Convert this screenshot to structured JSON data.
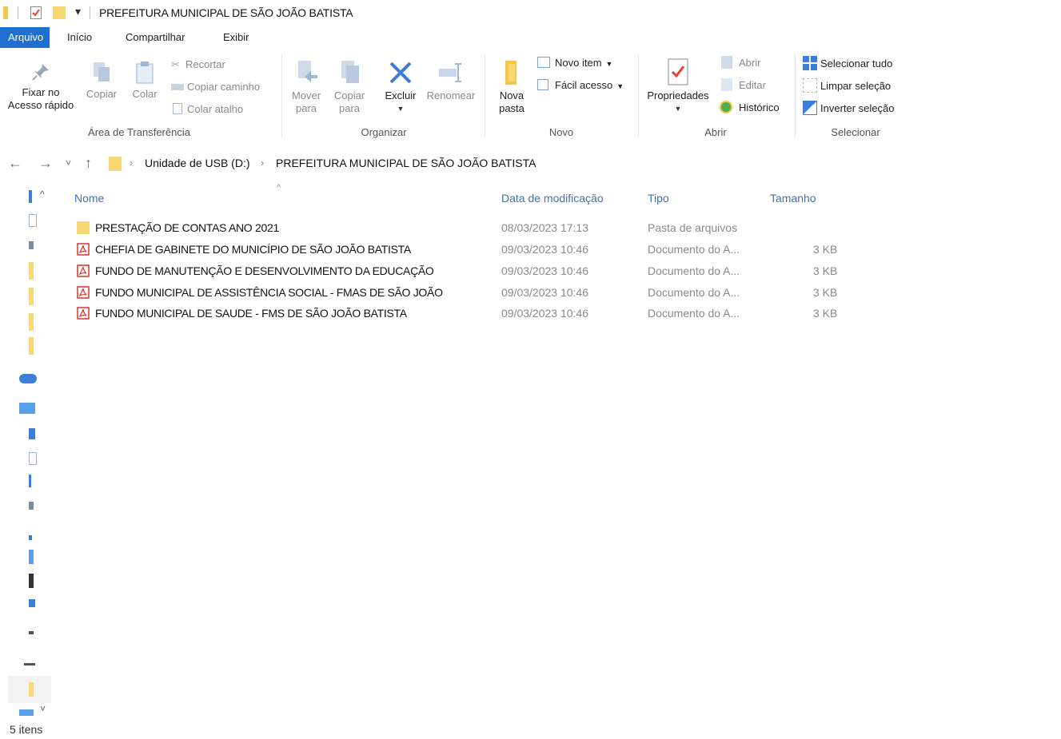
{
  "window": {
    "title": "PREFEITURA MUNICIPAL DE SÃO JOÃO BATISTA",
    "qa_menu_glyph": "▾"
  },
  "tabs": [
    {
      "label": "Arquivo",
      "active": true
    },
    {
      "label": "Início",
      "active": false
    },
    {
      "label": "Compartilhar",
      "active": false
    },
    {
      "label": "Exibir",
      "active": false
    }
  ],
  "ribbon": {
    "clipboard": {
      "pin_line1": "Fixar no",
      "pin_line2": "Acesso rápido",
      "copy": "Copiar",
      "paste": "Colar",
      "cut": "Recortar",
      "copy_path": "Copiar caminho",
      "paste_shortcut": "Colar atalho",
      "group": "Área de Transferência"
    },
    "organize": {
      "move_line1": "Mover",
      "move_line2": "para",
      "copyto_line1": "Copiar",
      "copyto_line2": "para",
      "delete": "Excluir",
      "rename": "Renomear",
      "group": "Organizar"
    },
    "new": {
      "folder_line1": "Nova",
      "folder_line2": "pasta",
      "new_item": "Novo item",
      "easy_access": "Fácil acesso",
      "group": "Novo"
    },
    "open": {
      "properties": "Propriedades",
      "open": "Abrir",
      "edit": "Editar",
      "history": "Histórico",
      "group": "Abrir"
    },
    "select": {
      "select_all": "Selecionar tudo",
      "clear": "Limpar seleção",
      "invert": "Inverter seleção",
      "group": "Selecionar"
    }
  },
  "address": {
    "back": "←",
    "forward": "→",
    "recent": "˅",
    "up": "↑",
    "sep": "›",
    "crumbs": [
      "Unidade de USB (D:)",
      "PREFEITURA MUNICIPAL DE SÃO JOÃO BATISTA"
    ]
  },
  "columns": {
    "name": "Nome",
    "date": "Data de modificação",
    "type": "Tipo",
    "size": "Tamanho",
    "sort_glyph": "^"
  },
  "files": [
    {
      "name": "PRESTAÇÃO DE CONTAS ANO 2021",
      "date": "08/03/2023 17:13",
      "type": "Pasta de arquivos",
      "size": "",
      "kind": "folder"
    },
    {
      "name": "CHEFIA DE GABINETE DO MUNICÍPIO DE SÃO JOÃO BATISTA",
      "date": "09/03/2023 10:46",
      "type": "Documento do A...",
      "size": "3 KB",
      "kind": "pdf"
    },
    {
      "name": "FUNDO DE MANUTENÇÃO E DESENVOLVIMENTO DA EDUCAÇÃO",
      "date": "09/03/2023 10:46",
      "type": "Documento do A...",
      "size": "3 KB",
      "kind": "pdf"
    },
    {
      "name": "FUNDO MUNICIPAL DE ASSISTÊNCIA SOCIAL - FMAS DE SÃO JOÃO",
      "date": "09/03/2023 10:46",
      "type": "Documento do A...",
      "size": "3 KB",
      "kind": "pdf"
    },
    {
      "name": "FUNDO MUNICIPAL DE SAUDE - FMS DE SÃO JOÃO BATISTA",
      "date": "09/03/2023 10:46",
      "type": "Documento do A...",
      "size": "3 KB",
      "kind": "pdf"
    }
  ],
  "status": {
    "items": "5 itens"
  },
  "colors": {
    "accent": "#1f6fd1",
    "folder": "#f8d775",
    "pdf": "#d9342b"
  }
}
